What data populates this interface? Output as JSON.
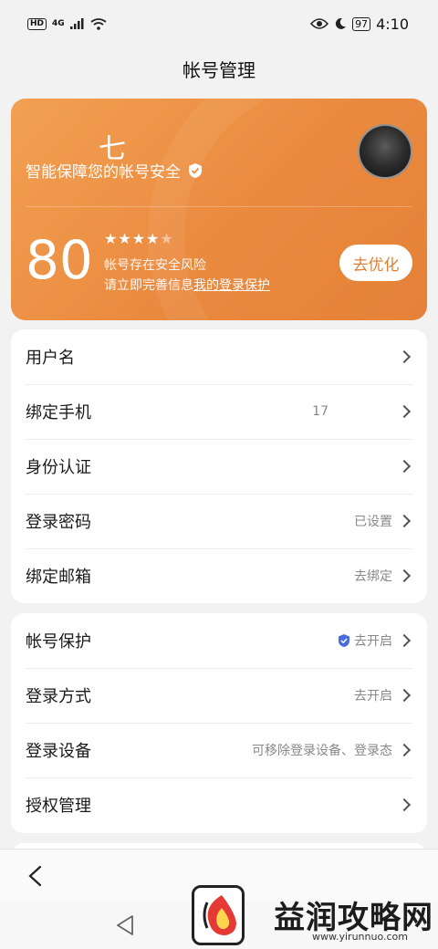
{
  "status_bar": {
    "hd": "HD",
    "network": "4G",
    "battery": "97",
    "time": "4:10"
  },
  "header": {
    "title": "帐号管理"
  },
  "security_card": {
    "nickname": "七",
    "safety_text": "智能保障您的帐号安全",
    "score": "80",
    "stars_filled": 4,
    "stars_total": 5,
    "risk_text": "帐号存在安全风险",
    "tip_prefix": "请立即完善信息",
    "tip_link": "我的登录保护",
    "optimize_label": "去优化",
    "accent_color": "#ea8a3f"
  },
  "group1": {
    "rows": [
      {
        "label": "用户名",
        "value": ""
      },
      {
        "label": "绑定手机",
        "value": "17"
      },
      {
        "label": "身份认证",
        "value": ""
      },
      {
        "label": "登录密码",
        "value": "已设置"
      },
      {
        "label": "绑定邮箱",
        "value": "去绑定"
      }
    ]
  },
  "group2": {
    "rows": [
      {
        "label": "帐号保护",
        "value": "去开启"
      },
      {
        "label": "登录方式",
        "value": "去开启"
      },
      {
        "label": "登录设备",
        "value": "可移除登录设备、登录态"
      },
      {
        "label": "授权管理",
        "value": ""
      }
    ]
  },
  "watermark": {
    "text": "益润攻略网",
    "url": "www.yirunnuo.com"
  },
  "icons": {
    "eye": "eye-icon",
    "moon": "moon-icon",
    "shield": "shield-icon",
    "chevron": "chevron-right-icon",
    "back": "back-arrow-icon"
  }
}
